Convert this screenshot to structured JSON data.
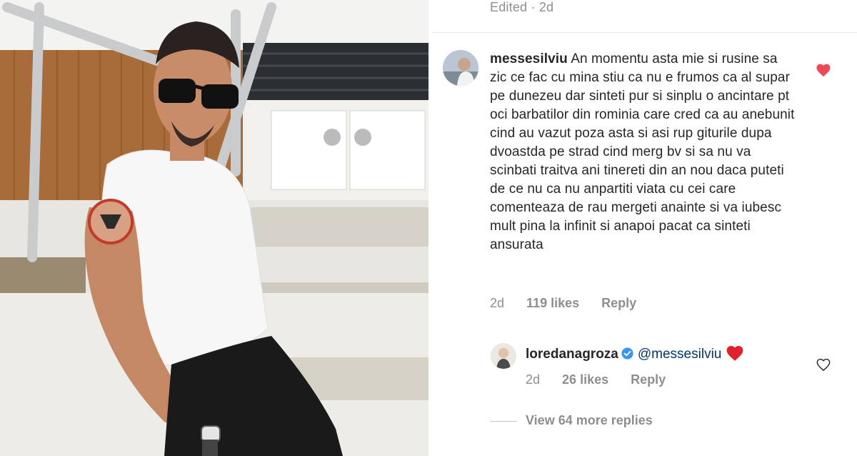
{
  "post_photo": {
    "description_icon": "photo-of-man"
  },
  "header": {
    "edited_label": "Edited · 2d"
  },
  "comment": {
    "username": "messesilviu",
    "text": "An momentu asta mie si rusine sa zic ce fac cu mina stiu ca nu e frumos ca al supar pe dunezeu dar sinteti pur si sinplu o ancintare pt oci barbatilor din rominia care cred ca au anebunit cind au vazut poza asta si asi rup giturile dupa dvoastda pe strad cind merg bv si sa nu va scinbati traitva ani tinereti din an nou daca puteti de ce nu ca nu anpartiti viata cu cei care comenteaza de rau mergeti anainte si va iubesc mult pina la infinit si anapoi pacat ca sinteti ansurata",
    "time": "2d",
    "likes": "119 likes",
    "reply_label": "Reply",
    "liked": true,
    "heart_color": "#ed4956"
  },
  "reply": {
    "username": "loredanagroza",
    "verified": true,
    "mention": "@messesilviu",
    "time": "2d",
    "likes": "26 likes",
    "reply_label": "Reply",
    "verified_color": "#3897f0"
  },
  "view_more": {
    "label": "View 64 more replies"
  }
}
